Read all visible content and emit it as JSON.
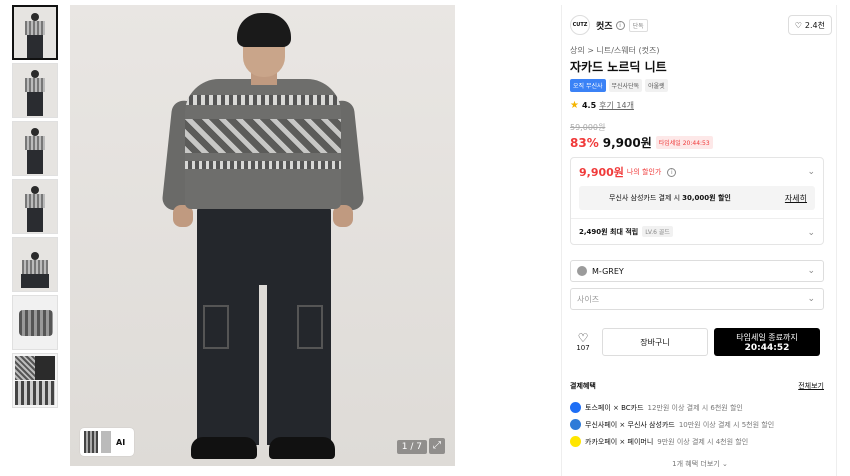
{
  "gallery": {
    "counter": "1 / 7",
    "ai_label": "AI"
  },
  "brand": {
    "logo_text": "CUTZ",
    "name": "컷즈",
    "tag": "단독",
    "likes": "2.4천"
  },
  "product": {
    "breadcrumb": "상의 > 니트/스웨터 (컷즈)",
    "title": "자카드 노르딕 니트",
    "tags": [
      "오직 무신사",
      "무신사단독",
      "아울렛"
    ],
    "rating": "4.5",
    "review_label": "후기 14개",
    "original_price": "59,000원",
    "discount": "83%",
    "price": "9,900원",
    "timesale": "타임세일 20:44:53"
  },
  "benefit": {
    "my_price": "9,900원",
    "my_price_label": "나의 할인가",
    "card_promo_prefix": "무신사 삼성카드 결제 시",
    "card_promo_amount": "30,000원 할인",
    "card_detail": "자세히",
    "points": "2,490원 최대 적립",
    "level": "LV.6 골드"
  },
  "options": {
    "color": "M-GREY",
    "size_placeholder": "사이즈"
  },
  "actions": {
    "wish_count": "107",
    "cart": "장바구니",
    "buy_line1": "타임세일 종료까지",
    "buy_line2": "20:44:52"
  },
  "payment": {
    "title": "결제혜택",
    "view_all": "전체보기",
    "rows": [
      {
        "name": "토스페이 × BC카드",
        "desc": "12만원 이상 결제 시 6천원 할인",
        "color": "#1e6ef5"
      },
      {
        "name": "무신사페이 × 무신사 삼성카드",
        "desc": "10만원 이상 결제 시 5천원 할인",
        "color": "#2f7bd8"
      },
      {
        "name": "카카오페이 × 페이머니",
        "desc": "9만원 이상 결제 시 4천원 할인",
        "color": "#ffe600"
      }
    ],
    "more": "1개 혜택 더보기"
  },
  "colors": {
    "accent_red": "#f03a3a",
    "tag_blue": "#3b82f6"
  }
}
